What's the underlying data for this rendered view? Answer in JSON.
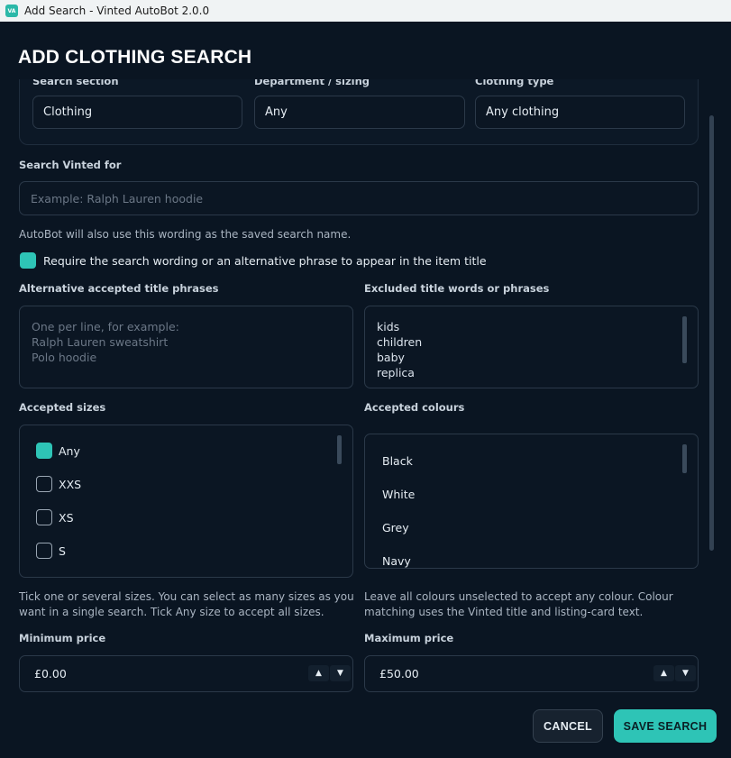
{
  "window": {
    "title": "Add Search - Vinted AutoBot 2.0.0",
    "icon_label": "VA"
  },
  "page_title": "ADD CLOTHING SEARCH",
  "search_section": {
    "label": "Search section",
    "value": "Clothing"
  },
  "department": {
    "label": "Department / sizing",
    "value": "Any"
  },
  "clothing_type": {
    "label": "Clothing type",
    "value": "Any clothing"
  },
  "search_query": {
    "label": "Search Vinted for",
    "placeholder": "Example: Ralph Lauren hoodie",
    "value": "",
    "hint": "AutoBot will also use this wording as the saved search name."
  },
  "require_wording": {
    "label": "Require the search wording or an alternative phrase to appear in the item title",
    "checked": true
  },
  "alt_phrases": {
    "label": "Alternative accepted title phrases",
    "placeholder_lines": [
      "One per line, for example:",
      "Ralph Lauren sweatshirt",
      "Polo hoodie"
    ]
  },
  "excluded": {
    "label": "Excluded title words or phrases",
    "lines": [
      "kids",
      "children",
      "baby",
      "replica"
    ]
  },
  "sizes": {
    "label": "Accepted sizes",
    "items": [
      {
        "label": "Any",
        "checked": true
      },
      {
        "label": "XXS",
        "checked": false
      },
      {
        "label": "XS",
        "checked": false
      },
      {
        "label": "S",
        "checked": false
      }
    ],
    "hint_lines": [
      "Tick one or several sizes. You can select as many sizes as you",
      "want in a single search. Tick Any size to accept all sizes."
    ]
  },
  "colours": {
    "label": "Accepted colours",
    "items": [
      "Black",
      "White",
      "Grey",
      "Navy"
    ],
    "hint_lines": [
      "Leave all colours unselected to accept any colour. Colour",
      "matching uses the Vinted title and listing-card text."
    ]
  },
  "min_price": {
    "label": "Minimum price",
    "value": "£0.00"
  },
  "max_price": {
    "label": "Maximum price",
    "value": "£50.00"
  },
  "buttons": {
    "cancel": "CANCEL",
    "save": "SAVE SEARCH"
  },
  "colors": {
    "accent": "#2ec4b6",
    "background": "#0a1522",
    "field_border": "#2b3949"
  }
}
